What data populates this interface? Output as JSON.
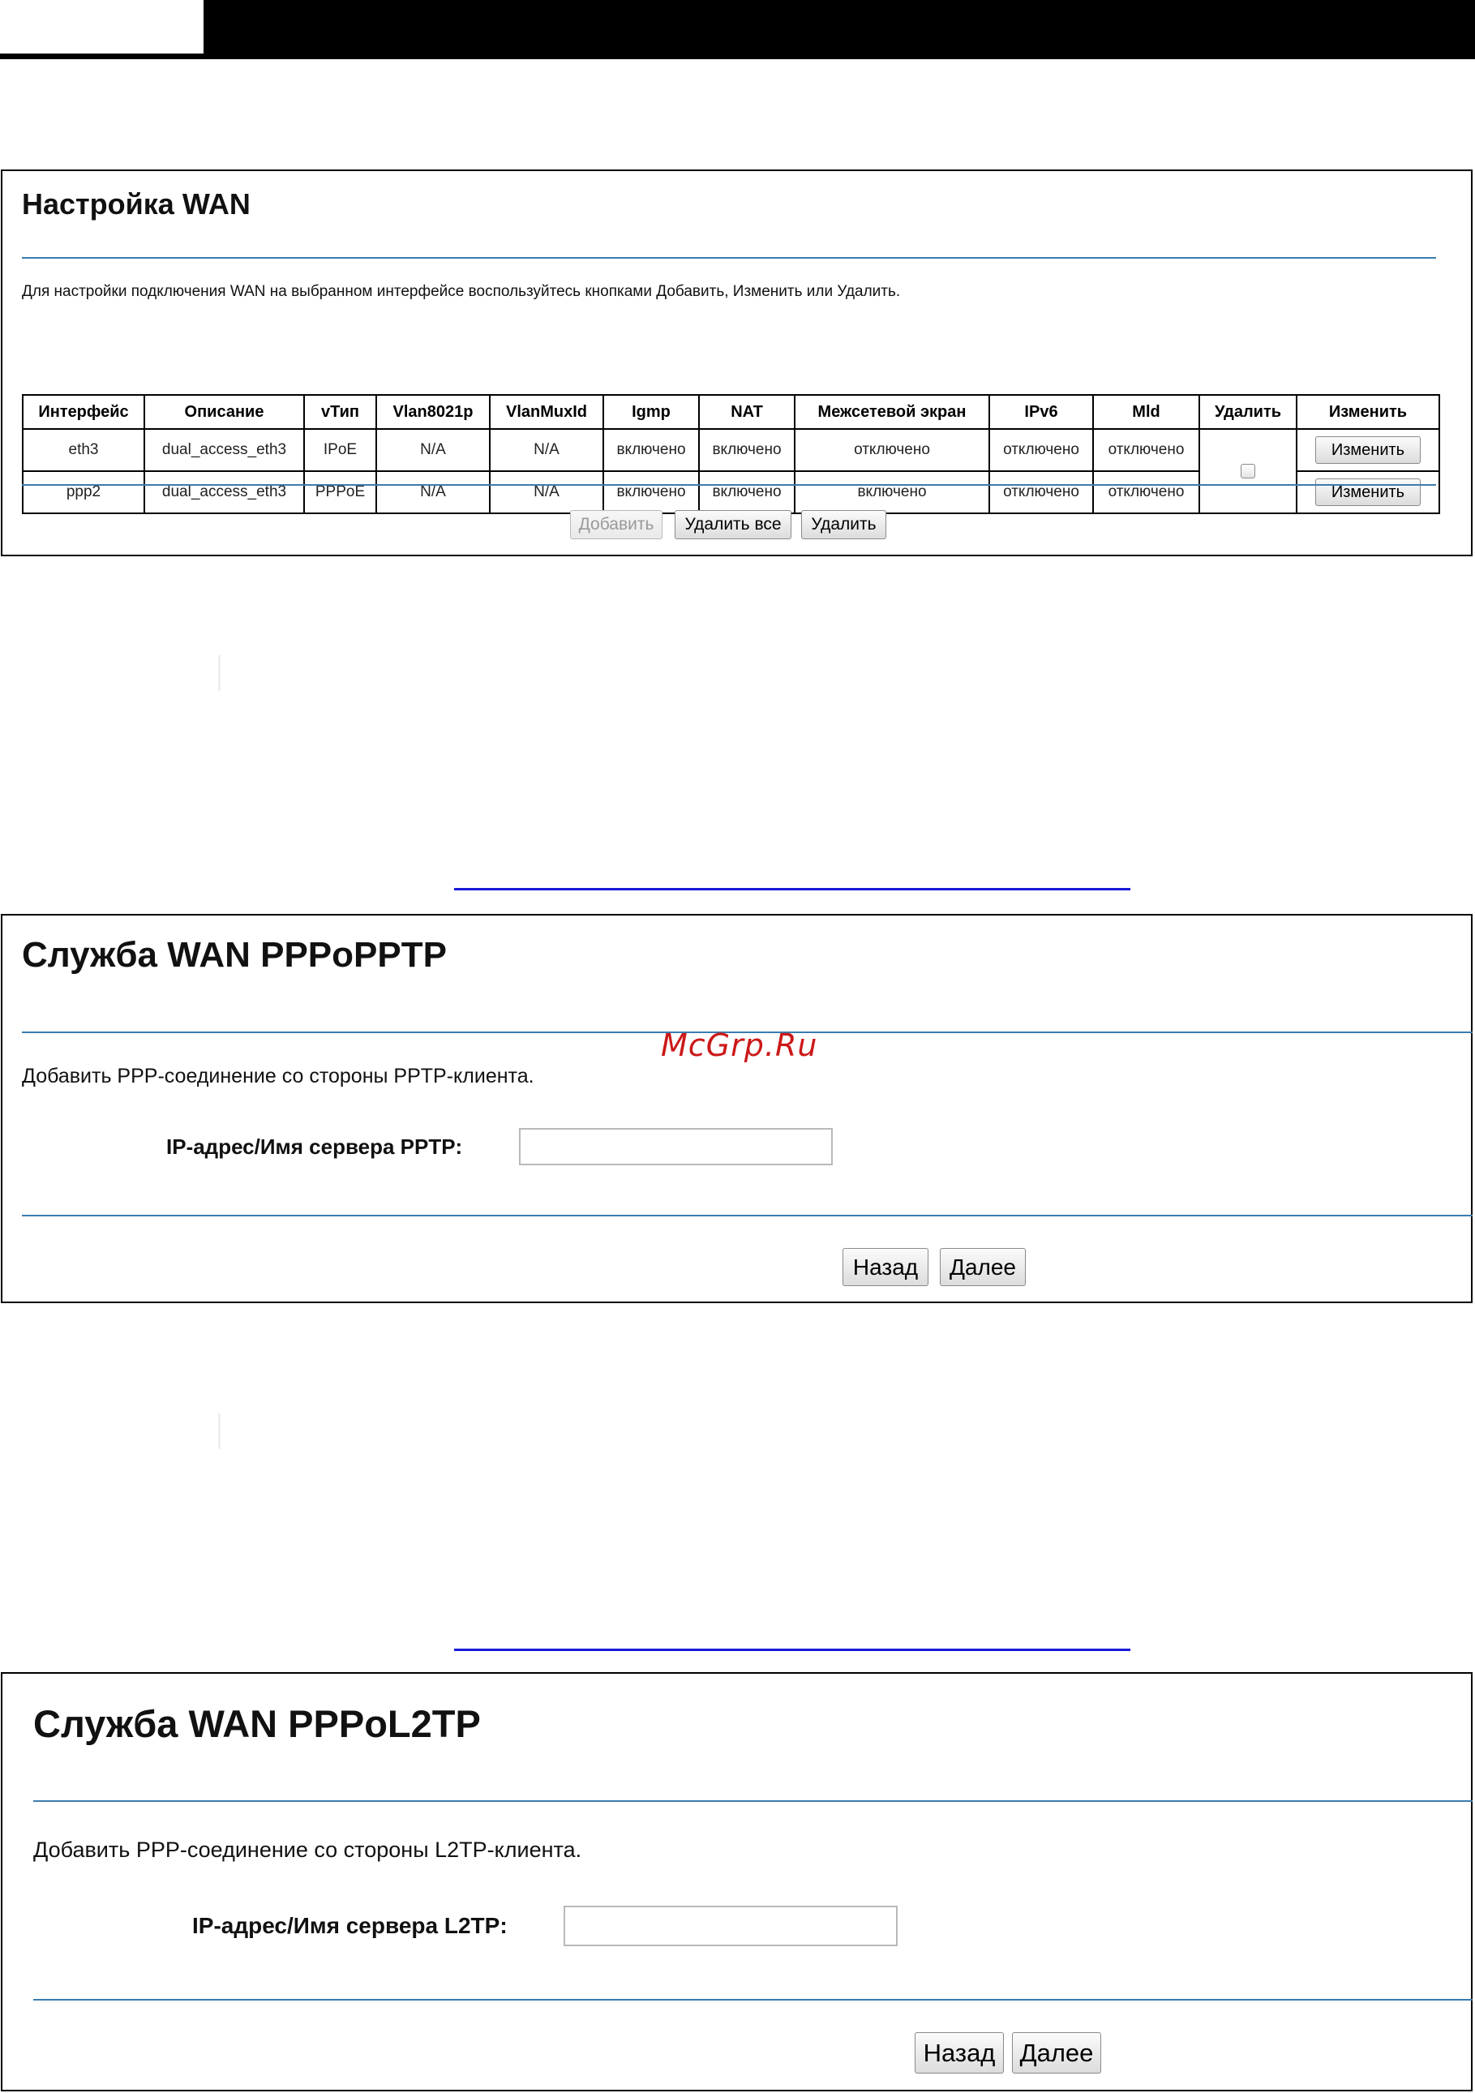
{
  "watermark": "McGrp.Ru",
  "wan_setup": {
    "title": "Настройка WAN",
    "description": "Для настройки подключения WAN на выбранном интерфейсе воспользуйтесь кнопками Добавить, Изменить или Удалить.",
    "columns": [
      "Интерфейс",
      "Описание",
      "vТип",
      "Vlan8021p",
      "VlanMuxId",
      "Igmp",
      "NAT",
      "Межсетевой экран",
      "IPv6",
      "Mld",
      "Удалить",
      "Изменить"
    ],
    "rows": [
      {
        "interface": "eth3",
        "description": "dual_access_eth3",
        "type": "IPoE",
        "vlan8021p": "N/A",
        "vlanmuxid": "N/A",
        "igmp": "включено",
        "nat": "включено",
        "firewall": "отключено",
        "ipv6": "отключено",
        "mld": "отключено",
        "edit_label": "Изменить"
      },
      {
        "interface": "ppp2",
        "description": "dual_access_eth3",
        "type": "PPPoE",
        "vlan8021p": "N/A",
        "vlanmuxid": "N/A",
        "igmp": "включено",
        "nat": "включено",
        "firewall": "включено",
        "ipv6": "отключено",
        "mld": "отключено",
        "edit_label": "Изменить"
      }
    ],
    "buttons": {
      "add": "Добавить",
      "delete_all": "Удалить все",
      "delete": "Удалить"
    }
  },
  "pptp": {
    "title": "Служба WAN PPPoPPTP",
    "description": "Добавить PPP-соединение со стороны PPTP-клиента.",
    "field_label": "IP-адрес/Имя сервера PPTP:",
    "field_value": "",
    "buttons": {
      "back": "Назад",
      "next": "Далее"
    }
  },
  "l2tp": {
    "title": "Служба WAN PPPoL2TP",
    "description": "Добавить PPP-соединение со стороны L2TP-клиента.",
    "field_label": "IP-адрес/Имя сервера L2TP:",
    "field_value": "",
    "buttons": {
      "back": "Назад",
      "next": "Далее"
    }
  }
}
